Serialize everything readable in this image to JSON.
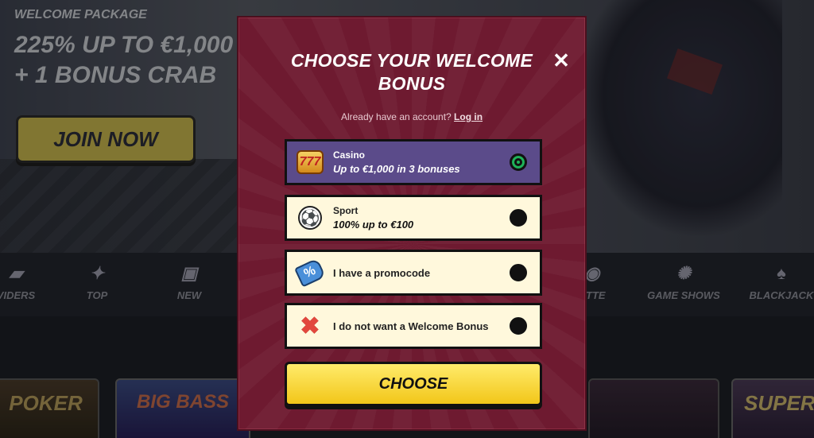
{
  "hero": {
    "tag": "WELCOME PACKAGE",
    "headline_line1": "225% UP TO €1,000",
    "headline_line2": "+ 1 BONUS CRAB",
    "join_label": "JOIN NOW"
  },
  "categories": [
    {
      "label": "VIDERS",
      "icon": "providers-icon"
    },
    {
      "label": "TOP",
      "icon": "star-icon"
    },
    {
      "label": "NEW",
      "icon": "new-badge-icon"
    },
    {
      "label": "ETTE",
      "icon": "roulette-icon"
    },
    {
      "label": "GAME SHOWS",
      "icon": "wheel-icon"
    },
    {
      "label": "BLACKJACK",
      "icon": "cards-icon"
    }
  ],
  "tiles": [
    {
      "text": "POKER"
    },
    {
      "text": "BIG BASS"
    },
    {
      "text": ""
    },
    {
      "text": "SUPER"
    }
  ],
  "modal": {
    "title_line1": "CHOOSE YOUR WELCOME",
    "title_line2": "BONUS",
    "close_symbol": "✕",
    "account_text": "Already have an account?",
    "login_link": "Log in",
    "options": [
      {
        "label": "Casino",
        "desc": "Up to €1,000 in 3 bonuses",
        "selected": true
      },
      {
        "label": "Sport",
        "desc": "100% up to €100",
        "selected": false
      },
      {
        "label": "I have a promocode",
        "selected": false
      },
      {
        "label": "I do not want a Welcome Bonus",
        "selected": false
      }
    ],
    "choose_label": "CHOOSE"
  },
  "colors": {
    "modal_bg": "#6e1a30",
    "selected_bg": "#5b4b8a",
    "option_bg": "#fff8dc",
    "button_yellow": "#f2c619",
    "radio_on": "#1fb35a"
  }
}
